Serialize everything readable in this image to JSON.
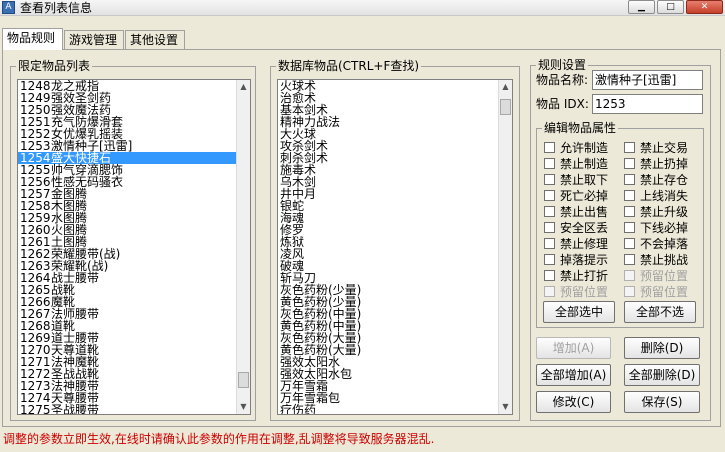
{
  "window": {
    "title": "查看列表信息",
    "icon_text": "A"
  },
  "tabs": [
    {
      "label": "物品规则"
    },
    {
      "label": "游戏管理"
    },
    {
      "label": "其他设置"
    }
  ],
  "restricted_list": {
    "legend": "限定物品列表",
    "selected_index": 6,
    "items": [
      {
        "id": "1248",
        "name": "龙之戒指"
      },
      {
        "id": "1249",
        "name": "强效圣剑药"
      },
      {
        "id": "1250",
        "name": "强效魔法药"
      },
      {
        "id": "1251",
        "name": "充气防爆滑套"
      },
      {
        "id": "1252",
        "name": "女优爆乳摇装"
      },
      {
        "id": "1253",
        "name": "激情种子[迅雷]"
      },
      {
        "id": "1254",
        "name": "盛大快捷石"
      },
      {
        "id": "1255",
        "name": "帅气穿滴腮饰"
      },
      {
        "id": "1256",
        "name": "性感无码骚衣"
      },
      {
        "id": "1257",
        "name": "金图腾"
      },
      {
        "id": "1258",
        "name": "木图腾"
      },
      {
        "id": "1259",
        "name": "水图腾"
      },
      {
        "id": "1260",
        "name": "火图腾"
      },
      {
        "id": "1261",
        "name": "土图腾"
      },
      {
        "id": "1262",
        "name": "荣耀腰带(战)"
      },
      {
        "id": "1263",
        "name": "荣耀靴(战)"
      },
      {
        "id": "1264",
        "name": "战士腰带"
      },
      {
        "id": "1265",
        "name": "战靴"
      },
      {
        "id": "1266",
        "name": "魔靴"
      },
      {
        "id": "1267",
        "name": "法师腰带"
      },
      {
        "id": "1268",
        "name": "道靴"
      },
      {
        "id": "1269",
        "name": "道士腰带"
      },
      {
        "id": "1270",
        "name": "天尊道靴"
      },
      {
        "id": "1271",
        "name": "法神魔靴"
      },
      {
        "id": "1272",
        "name": "圣战战靴"
      },
      {
        "id": "1273",
        "name": "法神腰带"
      },
      {
        "id": "1274",
        "name": "天尊腰带"
      },
      {
        "id": "1275",
        "name": "圣战腰带"
      }
    ]
  },
  "database_list": {
    "legend": "数据库物品(CTRL+F查找)",
    "items": [
      "火球术",
      "治愈术",
      "基本剑术",
      "精神力战法",
      "大火球",
      "攻杀剑术",
      "刺杀剑术",
      "施毒术",
      "乌木剑",
      "井中月",
      "银蛇",
      "海魂",
      "修罗",
      "炼狱",
      "凌风",
      "破魂",
      "斩马刀",
      "灰色药粉(少量)",
      "黄色药粉(少量)",
      "灰色药粉(中量)",
      "黄色药粉(中量)",
      "灰色药粉(大量)",
      "黄色药粉(大量)",
      "强效太阳水",
      "强效太阳水包",
      "万年雪霜",
      "万年雪霜包",
      "疗伤药"
    ]
  },
  "rules": {
    "legend": "规则设置",
    "item_name_label": "物品名称:",
    "item_name_value": "激情种子[迅雷]",
    "item_idx_label": "物品 IDX:",
    "item_idx_value": "1253"
  },
  "attributes": {
    "legend": "编辑物品属性",
    "checkboxes": [
      {
        "label": "允许制造",
        "enabled": true
      },
      {
        "label": "禁止交易",
        "enabled": true
      },
      {
        "label": "禁止制造",
        "enabled": true
      },
      {
        "label": "禁止扔掉",
        "enabled": true
      },
      {
        "label": "禁止取下",
        "enabled": true
      },
      {
        "label": "禁止存仓",
        "enabled": true
      },
      {
        "label": "死亡必掉",
        "enabled": true
      },
      {
        "label": "上线消失",
        "enabled": true
      },
      {
        "label": "禁止出售",
        "enabled": true
      },
      {
        "label": "禁止升级",
        "enabled": true
      },
      {
        "label": "安全区丢",
        "enabled": true
      },
      {
        "label": "下线必掉",
        "enabled": true
      },
      {
        "label": "禁止修理",
        "enabled": true
      },
      {
        "label": "不会掉落",
        "enabled": true
      },
      {
        "label": "掉落提示",
        "enabled": true
      },
      {
        "label": "禁止挑战",
        "enabled": true
      },
      {
        "label": "禁止打折",
        "enabled": true
      },
      {
        "label": "预留位置",
        "enabled": false
      },
      {
        "label": "预留位置",
        "enabled": false
      },
      {
        "label": "预留位置",
        "enabled": false
      }
    ],
    "select_all_label": "全部选中",
    "deselect_all_label": "全部不选"
  },
  "actions": {
    "add_label": "增加(A)",
    "delete_label": "删除(D)",
    "add_all_label": "全部增加(A)",
    "delete_all_label": "全部删除(D)",
    "modify_label": "修改(C)",
    "save_label": "保存(S)"
  },
  "status_text": "调整的参数立即生效,在线时请确认此参数的作用在调整,乱调整将导致服务器混乱."
}
